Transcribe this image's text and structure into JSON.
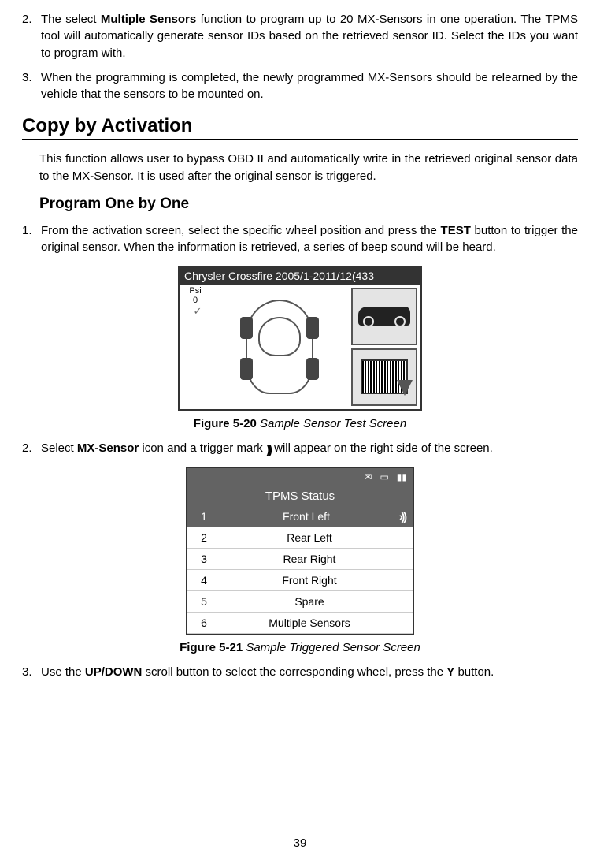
{
  "list_top": [
    {
      "n": "2.",
      "text_before": "The select ",
      "bold1": "Multiple Sensors",
      "text_mid": " function to program up to 20 MX-Sensors in one operation. The TPMS tool will automatically generate sensor IDs based on the retrieved sensor ID. Select the IDs you want to program with."
    },
    {
      "n": "3.",
      "text": "When the programming is completed, the newly programmed MX-Sensors should be relearned by the vehicle that the sensors to be mounted on."
    }
  ],
  "section_title": "Copy by Activation",
  "intro": "This function allows user to bypass OBD II and automatically write in the retrieved original sensor data to the MX-Sensor. It is used after the original sensor is triggered.",
  "subsection": "Program One by One",
  "list_main": [
    {
      "n": "1.",
      "pre": "From the activation screen, select the specific wheel position and press the ",
      "bold": "TEST",
      "post": " button to trigger the original sensor. When the information is retrieved, a series of beep sound will be heard."
    },
    {
      "n": "2.",
      "pre": "Select ",
      "bold": "MX-Sensor",
      "mid": " icon and a trigger mark ",
      "post": " will appear on the right side of the screen."
    },
    {
      "n": "3.",
      "pre": "Use the ",
      "bold": "UP/DOWN",
      "mid": " scroll button to select the corresponding wheel, press the ",
      "bold2": "Y",
      "post": " button."
    }
  ],
  "figure1": {
    "device_title": "Chrysler Crossfire 2005/1-2011/12(433",
    "psi_label": "Psi",
    "psi_value": "0",
    "caption_bold": "Figure 5-20",
    "caption_italic": " Sample Sensor Test Screen"
  },
  "figure2": {
    "header": "TPMS Status",
    "items": [
      {
        "n": "1",
        "label": "Front Left",
        "selected": true,
        "signal": true
      },
      {
        "n": "2",
        "label": "Rear Left"
      },
      {
        "n": "3",
        "label": "Rear Right"
      },
      {
        "n": "4",
        "label": "Front Right"
      },
      {
        "n": "5",
        "label": "Spare"
      },
      {
        "n": "6",
        "label": "Multiple Sensors"
      }
    ],
    "caption_bold": "Figure 5-21",
    "caption_italic": " Sample Triggered Sensor Screen"
  },
  "page_number": "39"
}
